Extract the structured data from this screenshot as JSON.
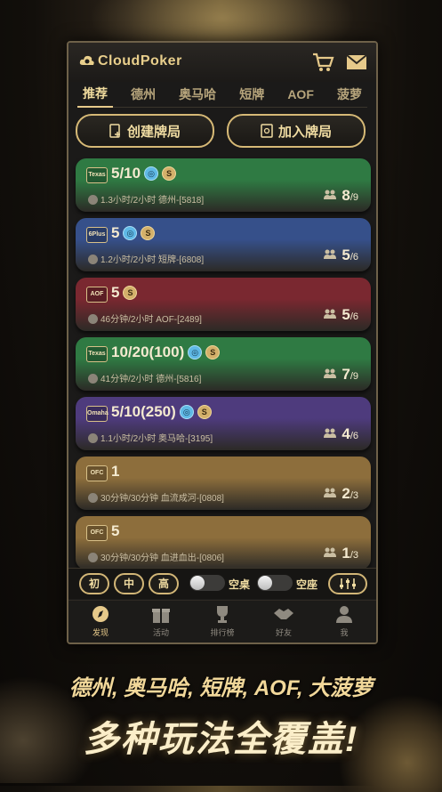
{
  "app": {
    "title": "CloudPoker"
  },
  "tabs": [
    {
      "label": "推荐"
    },
    {
      "label": "德州"
    },
    {
      "label": "奥马哈"
    },
    {
      "label": "短牌"
    },
    {
      "label": "AOF"
    },
    {
      "label": "菠萝"
    }
  ],
  "actions": {
    "create": "创建牌局",
    "join": "加入牌局"
  },
  "rooms": [
    {
      "icon_text": "Texas",
      "blinds": "5/10",
      "insurance": true,
      "s_badge": true,
      "meta": "1.3小时/2小时   德州-[5818]",
      "players": "8",
      "max": "/9",
      "color": "#2f7a43"
    },
    {
      "icon_text": "6Plus",
      "blinds": "5",
      "insurance": true,
      "s_badge": true,
      "meta": "1.2小时/2小时   短牌-[6808]",
      "players": "5",
      "max": "/6",
      "color": "#36508a"
    },
    {
      "icon_text": "AOF",
      "blinds": "5",
      "insurance": false,
      "s_badge": true,
      "meta": "46分钟/2小时   AOF-[2489]",
      "players": "5",
      "max": "/6",
      "color": "#7a2830"
    },
    {
      "icon_text": "Texas",
      "blinds": "10/20(100)",
      "insurance": true,
      "s_badge": true,
      "meta": "41分钟/2小时   德州-[5816]",
      "players": "7",
      "max": "/9",
      "color": "#2f7a43"
    },
    {
      "icon_text": "Omaha",
      "blinds": "5/10(250)",
      "insurance": true,
      "s_badge": true,
      "meta": "1.1小时/2小时   奥马哈-[3195]",
      "players": "4",
      "max": "/6",
      "color": "#4e3b7d"
    },
    {
      "icon_text": "OFC",
      "blinds": "1",
      "insurance": false,
      "s_badge": false,
      "meta": "30分钟/30分钟   血流成河-[0808]",
      "players": "2",
      "max": "/3",
      "color": "#8d6e3c"
    },
    {
      "icon_text": "OFC",
      "blinds": "5",
      "insurance": false,
      "s_badge": false,
      "meta": "30分钟/30分钟   血进血出-[0806]",
      "players": "1",
      "max": "/3",
      "color": "#8d6e3c"
    }
  ],
  "filters": {
    "levels": [
      "初",
      "中",
      "高"
    ],
    "toggle1": "空桌",
    "toggle2": "空座"
  },
  "nav": [
    {
      "label": "发现",
      "icon": "compass-icon"
    },
    {
      "label": "活动",
      "icon": "gift-icon"
    },
    {
      "label": "排行榜",
      "icon": "trophy-icon"
    },
    {
      "label": "好友",
      "icon": "handshake-icon"
    },
    {
      "label": "我",
      "icon": "user-icon"
    }
  ],
  "promo": {
    "tagline": "德州, 奥马哈, 短牌, AOF, 大菠萝",
    "slogan": "多种玩法全覆盖!"
  },
  "colors": {
    "gold": "#e6c98a",
    "bg": "#120f0b"
  }
}
